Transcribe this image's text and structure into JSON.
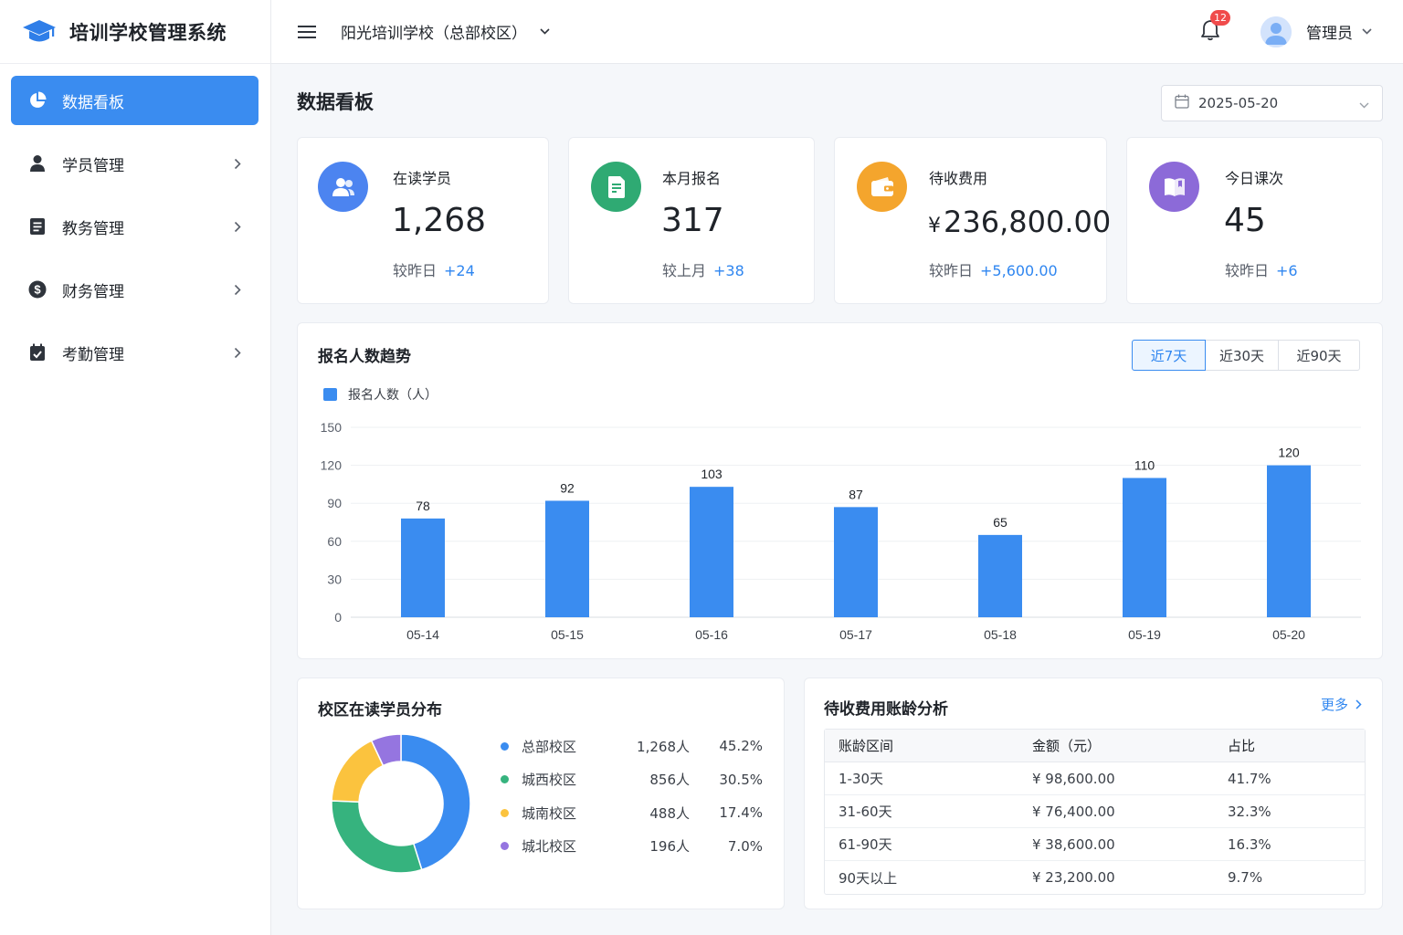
{
  "app": {
    "title": "培训学校管理系统"
  },
  "sidebar": {
    "items": [
      {
        "label": "数据看板",
        "active": true,
        "icon": "pie-chart-icon"
      },
      {
        "label": "学员管理",
        "icon": "user-icon"
      },
      {
        "label": "教务管理",
        "icon": "document-icon"
      },
      {
        "label": "财务管理",
        "icon": "dollar-icon"
      },
      {
        "label": "考勤管理",
        "icon": "calendar-check-icon"
      }
    ]
  },
  "header": {
    "school": "阳光培训学校（总部校区）",
    "notification_count": "12",
    "user_name": "管理员"
  },
  "page": {
    "title": "数据看板",
    "date": "2025-05-20"
  },
  "stats": [
    {
      "label": "在读学员",
      "value": "1,268",
      "compare_label": "较昨日",
      "delta": "+24",
      "icon": "users-icon",
      "color": "#4c84f0"
    },
    {
      "label": "本月报名",
      "value": "317",
      "compare_label": "较上月",
      "delta": "+38",
      "icon": "form-icon",
      "color": "#2faa73"
    },
    {
      "label": "待收费用",
      "currency": "¥",
      "value": "236,800.00",
      "compare_label": "较昨日",
      "delta": "+5,600.00",
      "icon": "wallet-icon",
      "color": "#f4a52d"
    },
    {
      "label": "今日课次",
      "value": "45",
      "compare_label": "较昨日",
      "delta": "+6",
      "icon": "book-icon",
      "color": "#8c6ad8"
    }
  ],
  "trend": {
    "title": "报名人数趋势",
    "tabs": [
      "近7天",
      "近30天",
      "近90天"
    ],
    "active_tab": 0
  },
  "chart_data": {
    "type": "bar",
    "categories": [
      "05-14",
      "05-15",
      "05-16",
      "05-17",
      "05-18",
      "05-19",
      "05-20"
    ],
    "series": [
      {
        "name": "报名人数（人）",
        "values": [
          78,
          92,
          103,
          87,
          65,
          110,
          120
        ],
        "color": "#3a8cf0"
      }
    ],
    "ylim": [
      0,
      150
    ],
    "yticks": [
      0,
      30,
      60,
      90,
      120,
      150
    ],
    "data_labels": true,
    "grid": true,
    "legend": "top-left"
  },
  "distribution": {
    "title": "校区在读学员分布",
    "items": [
      {
        "name": "总部校区",
        "count": "1,268人",
        "pct": "45.2%",
        "value": 45.2,
        "color": "#3a8cf0"
      },
      {
        "name": "城西校区",
        "count": "856人",
        "pct": "30.5%",
        "value": 30.5,
        "color": "#36b37e"
      },
      {
        "name": "城南校区",
        "count": "488人",
        "pct": "17.4%",
        "value": 17.4,
        "color": "#fbc33e"
      },
      {
        "name": "城北校区",
        "count": "196人",
        "pct": "7.0%",
        "value": 7.0,
        "color": "#9575e0"
      }
    ]
  },
  "aging": {
    "title": "待收费用账龄分析",
    "more": "更多",
    "columns": [
      "账龄区间",
      "金额（元）",
      "占比"
    ],
    "rows": [
      [
        "1-30天",
        "¥ 98,600.00",
        "41.7%"
      ],
      [
        "31-60天",
        "¥ 76,400.00",
        "32.3%"
      ],
      [
        "61-90天",
        "¥ 38,600.00",
        "16.3%"
      ],
      [
        "90天以上",
        "¥ 23,200.00",
        "9.7%"
      ]
    ]
  }
}
